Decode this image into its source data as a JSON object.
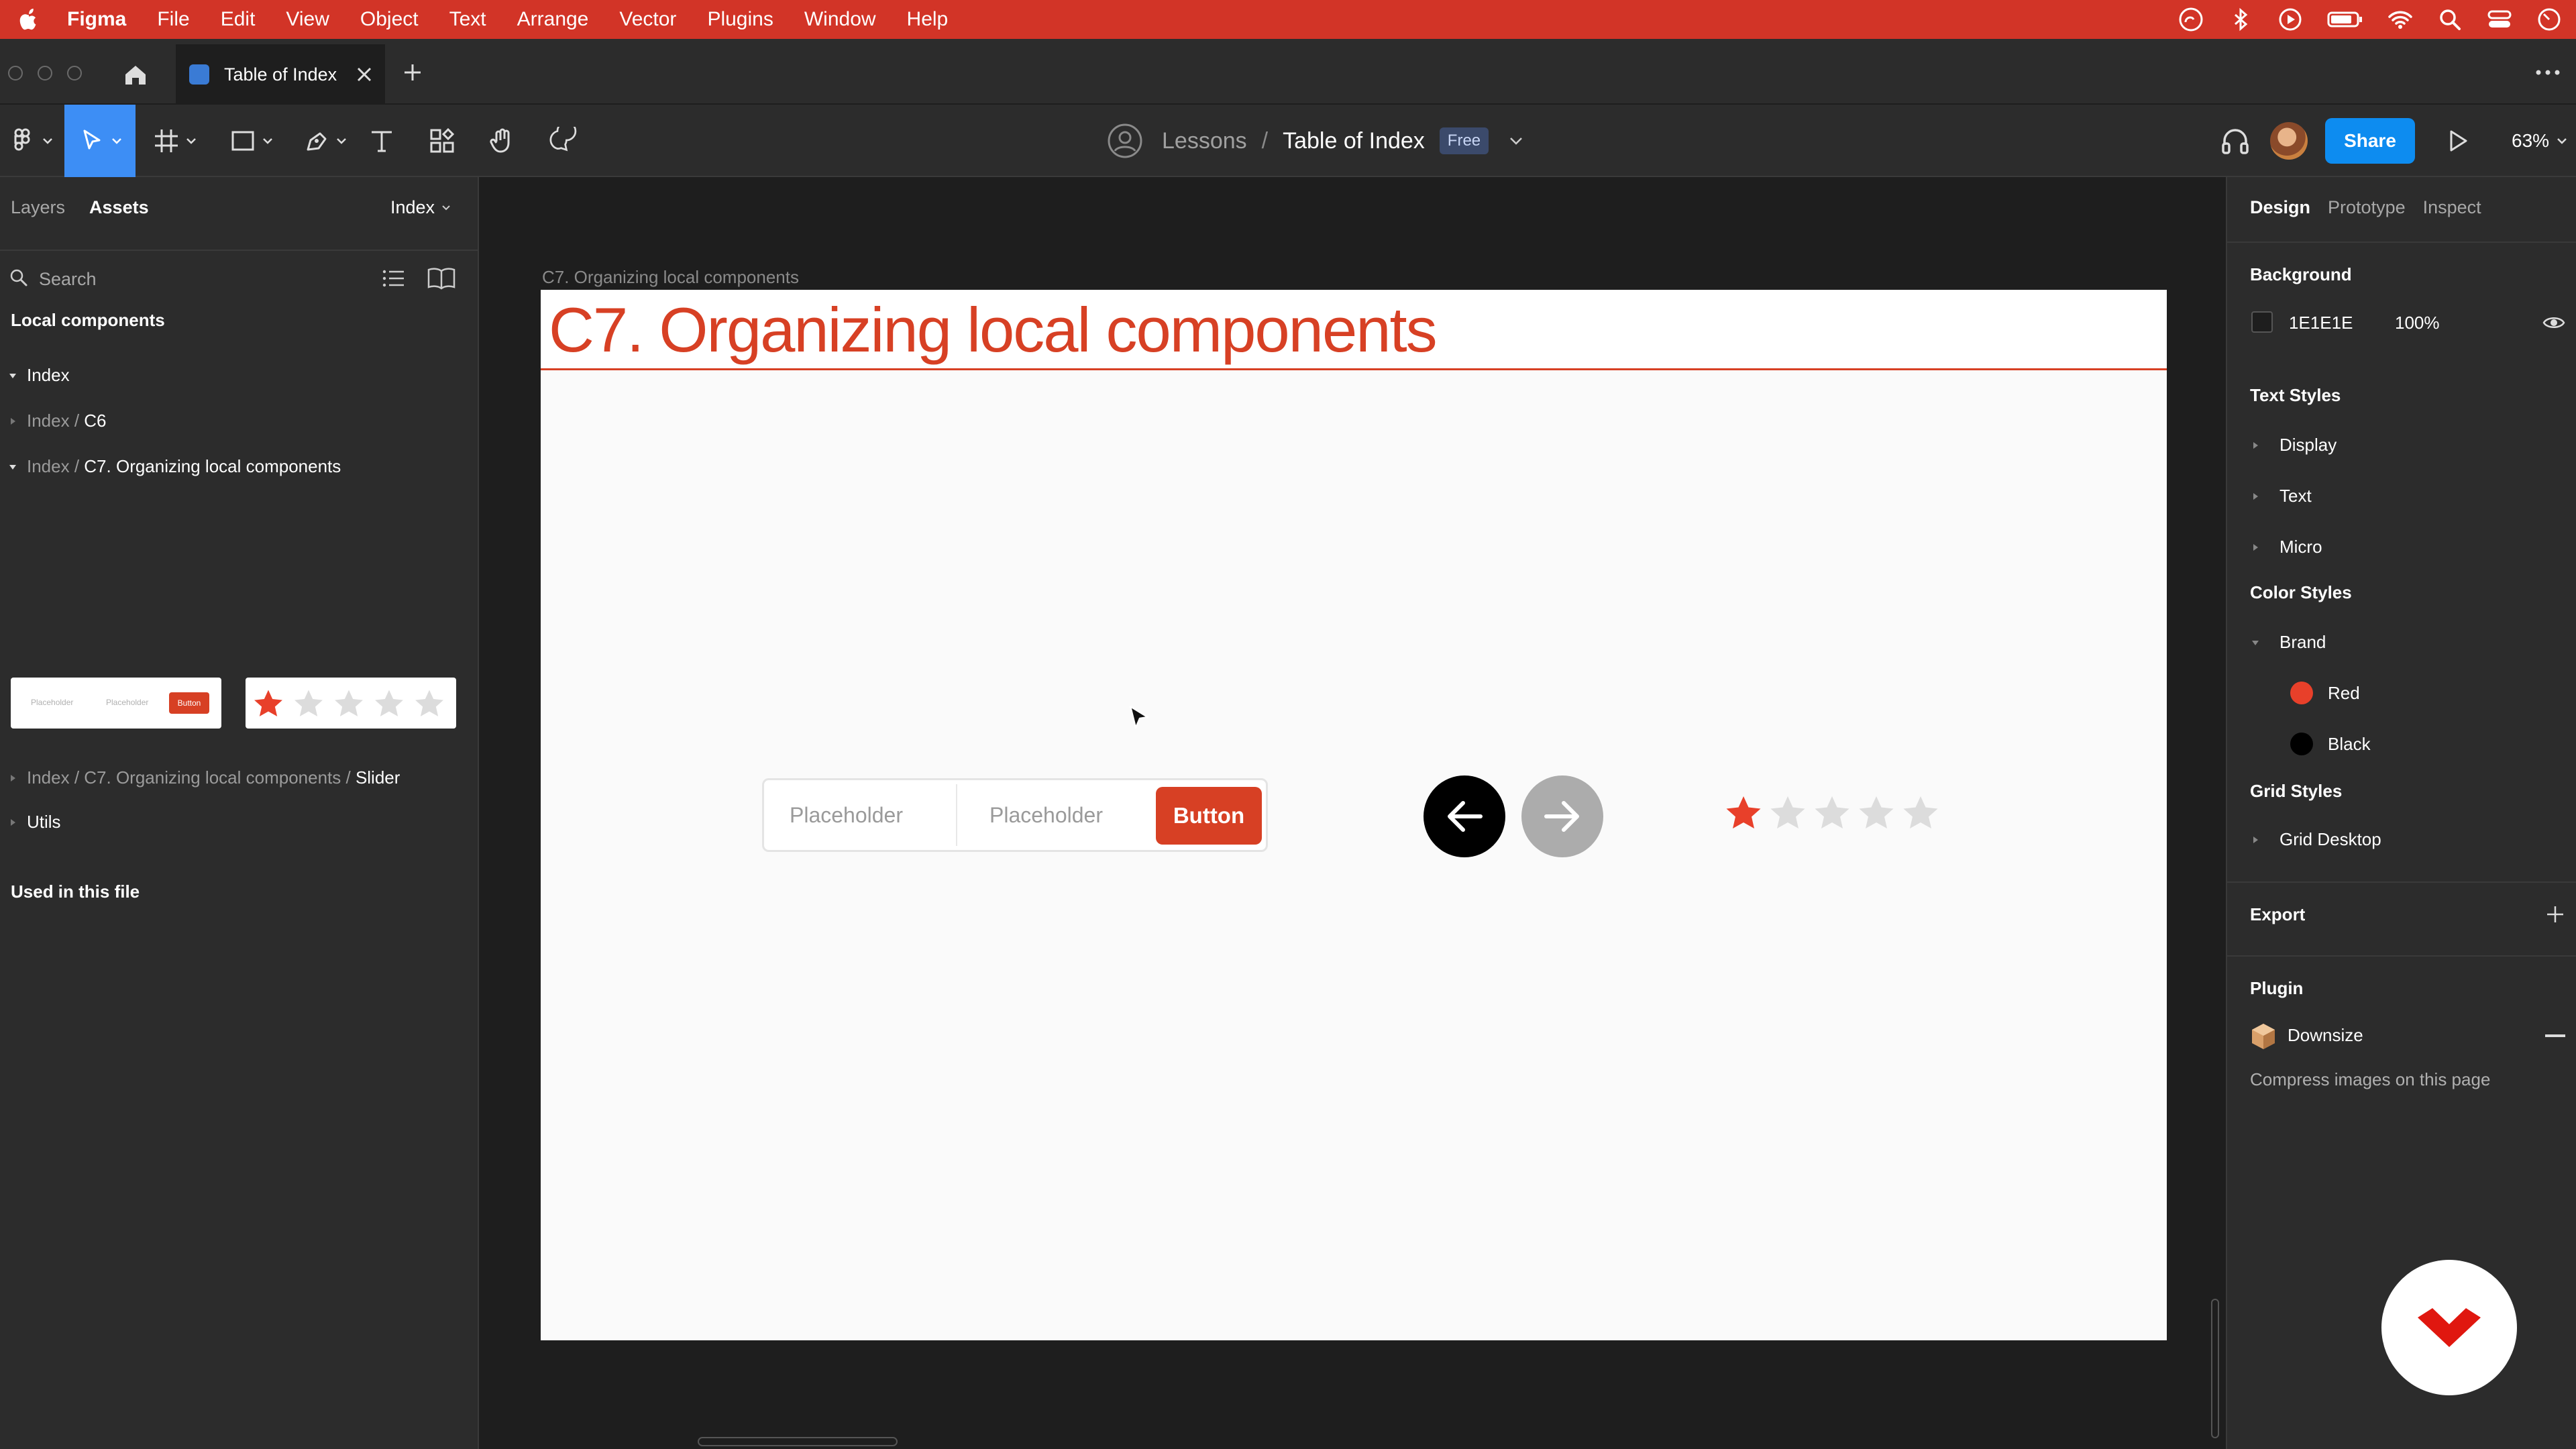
{
  "menubar": {
    "app_name": "Figma",
    "items": [
      "File",
      "Edit",
      "View",
      "Object",
      "Text",
      "Arrange",
      "Vector",
      "Plugins",
      "Window",
      "Help"
    ],
    "status_icons": [
      "creative-cloud-icon",
      "bluetooth-icon",
      "play-circle-icon",
      "battery-icon",
      "wifi-icon",
      "spotlight-search-icon",
      "control-center-icon",
      "timer-icon"
    ]
  },
  "tabbar": {
    "tab_title": "Table of Index"
  },
  "toolbar": {
    "project": "Lessons",
    "separator": "/",
    "file_name": "Table of Index",
    "plan_badge": "Free",
    "share_label": "Share",
    "zoom": "63%"
  },
  "left_panel": {
    "tab_layers": "Layers",
    "tab_assets": "Assets",
    "page": "Index",
    "search_placeholder": "Search",
    "local_components": "Local components",
    "rows": {
      "index": "Index",
      "c6_prefix": "Index / ",
      "c6_name": "C6",
      "c7_prefix": "Index / ",
      "c7_name": "C7. Organizing local components",
      "slider_prefix": "Index / C7. Organizing local components / ",
      "slider_name": "Slider",
      "utils": "Utils"
    },
    "thumb": {
      "placeholder_1": "Placeholder",
      "placeholder_2": "Placeholder",
      "button": "Button"
    },
    "used_in_file": "Used in this file"
  },
  "canvas": {
    "frame_label": "C7. Organizing local components",
    "frame_title": "C7.  Organizing local components",
    "field_1_placeholder": "Placeholder",
    "field_2_placeholder": "Placeholder",
    "button_label": "Button",
    "rating": 1,
    "rating_max": 5
  },
  "right_panel": {
    "tab_design": "Design",
    "tab_prototype": "Prototype",
    "tab_inspect": "Inspect",
    "background_title": "Background",
    "background_hex": "1E1E1E",
    "background_opacity": "100%",
    "text_styles_title": "Text Styles",
    "text_styles": [
      "Display",
      "Text",
      "Micro"
    ],
    "color_styles_title": "Color Styles",
    "color_group": "Brand",
    "colors": [
      {
        "name": "Red",
        "hex": "#e8402a"
      },
      {
        "name": "Black",
        "hex": "#000000"
      }
    ],
    "grid_styles_title": "Grid Styles",
    "grid_styles": [
      "Grid Desktop"
    ],
    "export_title": "Export",
    "plugin_title": "Plugin",
    "plugin_name": "Downsize",
    "plugin_description": "Compress images on this page"
  },
  "colors": {
    "menubar": "#d23427",
    "accent": "#0d8cf0",
    "brand_red": "#d74024"
  }
}
